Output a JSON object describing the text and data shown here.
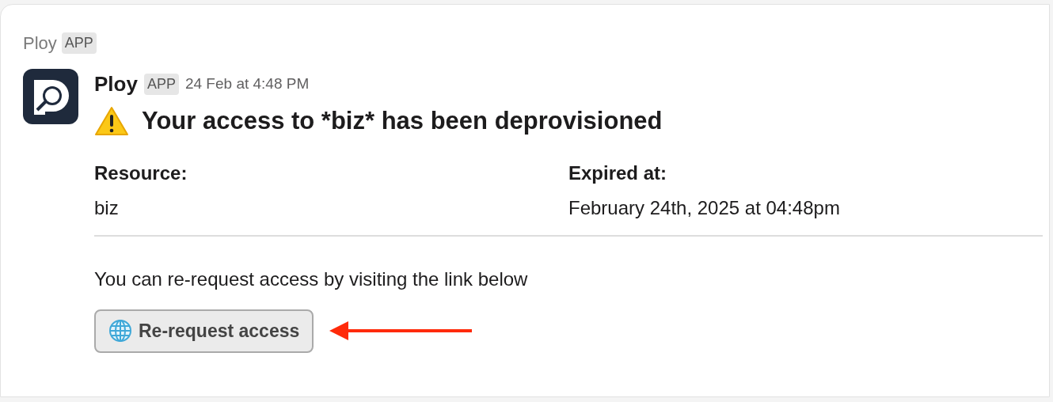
{
  "header": {
    "name": "Ploy",
    "badge": "APP"
  },
  "message": {
    "sender": "Ploy",
    "badge": "APP",
    "time": "24 Feb at 4:48 PM",
    "title": "Your access to *biz* has been deprovisioned",
    "fields": [
      {
        "label": "Resource:",
        "value": "biz"
      },
      {
        "label": "Expired at:",
        "value": "February 24th, 2025 at 04:48pm"
      }
    ],
    "note": "You can re-request access by visiting the link below",
    "button": {
      "label": "Re-request access"
    }
  }
}
